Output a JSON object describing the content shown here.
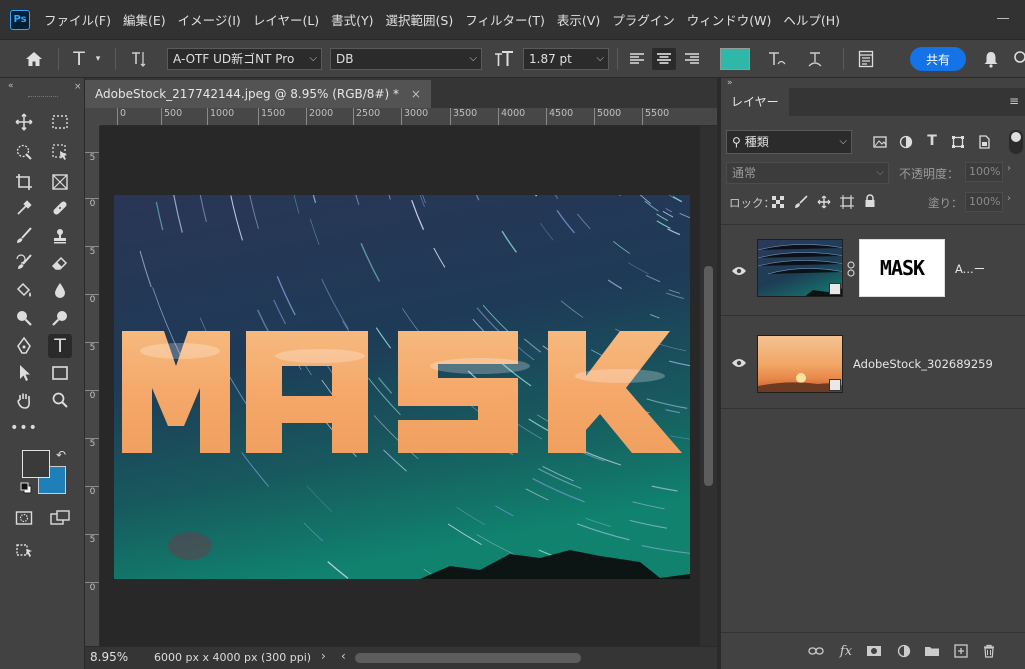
{
  "app": {
    "logo_text": "Ps"
  },
  "menu": [
    "ファイル(F)",
    "編集(E)",
    "イメージ(I)",
    "レイヤー(L)",
    "書式(Y)",
    "選択範囲(S)",
    "フィルター(T)",
    "表示(V)",
    "プラグイン",
    "ウィンドウ(W)",
    "ヘルプ(H)"
  ],
  "options": {
    "font_family": "A-OTF UD新ゴNT Pro",
    "font_style": "DB",
    "font_size": "1.87 pt",
    "text_color": "#2fb7a8",
    "share_label": "共有"
  },
  "document": {
    "tab_title": "AdobeStock_217742144.jpeg @ 8.95% (RGB/8#) *",
    "close_glyph": "×",
    "zoom": "8.95%",
    "doc_info": "6000 px x 4000 px (300 ppi)",
    "canvas_text": "MASK",
    "ruler_top": [
      "0",
      "500",
      "1000",
      "1500",
      "2000",
      "2500",
      "3000",
      "3500",
      "4000",
      "4500",
      "5000",
      "5500"
    ],
    "ruler_left": [
      "5",
      "0",
      "5",
      "0",
      "5",
      "0",
      "5",
      "0",
      "5",
      "0"
    ]
  },
  "layers_panel": {
    "tab_label": "レイヤー",
    "filter_label": "種類",
    "blend_mode": "通常",
    "opacity_label": "不透明度：",
    "opacity_value": "100%",
    "lock_label": "ロック：",
    "fill_label": "塗り：",
    "fill_value": "100%",
    "layers": [
      {
        "name": "A...ー",
        "mask_text": "MASK"
      },
      {
        "name": "AdobeStock_302689259"
      }
    ]
  }
}
